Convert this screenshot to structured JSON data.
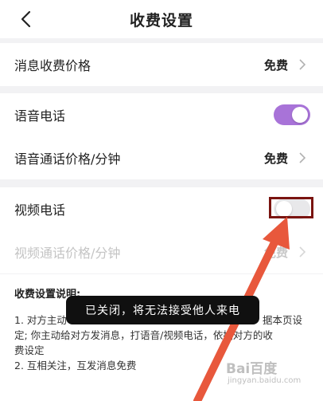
{
  "header": {
    "title": "收费设置"
  },
  "rows": [
    {
      "label": "消息收费价格",
      "value": "免费"
    },
    {
      "label": "语音电话",
      "toggle": "on"
    },
    {
      "label": "语音通话价格/分钟",
      "value": "免费"
    },
    {
      "label": "视频电话",
      "toggle": "off"
    },
    {
      "label": "视频通话价格/分钟",
      "value": "免费"
    }
  ],
  "description": {
    "title": "收费设置说明:",
    "lines": [
      "1. 对方主动",
      "据本页设",
      "定;  你主动给对方发消息，打语音/视频电话，依据对方的收",
      "费设定",
      "2. 互相关注，互发消息免费"
    ]
  },
  "toast": {
    "text": "已关闭，将无法接受他人来电"
  },
  "watermark": {
    "text": "Bai百度",
    "sub": "jingyan.baidu.com"
  },
  "colors": {
    "accent": "#a873d8",
    "highlight": "#7a1410",
    "arrow": "#e8583c"
  }
}
